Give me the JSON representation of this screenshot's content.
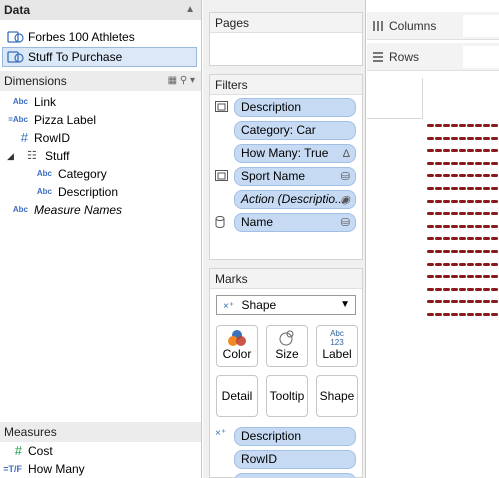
{
  "data_pane": {
    "title": "Data",
    "datasources": [
      {
        "label": "Forbes 100 Athletes",
        "selected": false
      },
      {
        "label": "Stuff To Purchase",
        "selected": true
      }
    ]
  },
  "dimensions": {
    "title": "Dimensions",
    "fields": [
      {
        "type": "Abc",
        "label": "Link"
      },
      {
        "type": "=Abc",
        "label": "Pizza Label"
      },
      {
        "type": "#",
        "label": "RowID"
      }
    ],
    "folder": {
      "label": "Stuff",
      "children": [
        {
          "type": "Abc",
          "label": "Category"
        },
        {
          "type": "Abc",
          "label": "Description"
        }
      ]
    },
    "measure_names": {
      "type": "Abc",
      "label": "Measure Names"
    }
  },
  "measures": {
    "title": "Measures",
    "fields": [
      {
        "type": "#",
        "label": "Cost"
      },
      {
        "type": "=T/F",
        "label": "How Many"
      }
    ]
  },
  "pages": {
    "title": "Pages"
  },
  "filters": {
    "title": "Filters",
    "pills": [
      {
        "label": "Description",
        "italic": false
      },
      {
        "label": "Category: Car",
        "italic": false
      },
      {
        "label": "How Many: True",
        "italic": false
      },
      {
        "label": "Sport Name",
        "italic": false
      },
      {
        "label": "Action (Descriptio...",
        "italic": true
      },
      {
        "label": "Name",
        "italic": false
      }
    ]
  },
  "marks": {
    "title": "Marks",
    "mark_type": "Shape",
    "buttons": [
      "Color",
      "Size",
      "Label",
      "Detail",
      "Tooltip",
      "Shape"
    ],
    "label_button_text": [
      "Abc",
      "123"
    ],
    "pills": [
      {
        "label": "Description"
      },
      {
        "label": "RowID"
      }
    ]
  },
  "shelves": {
    "columns": "Columns",
    "rows": "Rows"
  },
  "colors": {
    "pill_bg": "#c7daf3",
    "mark": "#8a1a1a",
    "selected_bg": "#dbe8f8"
  }
}
